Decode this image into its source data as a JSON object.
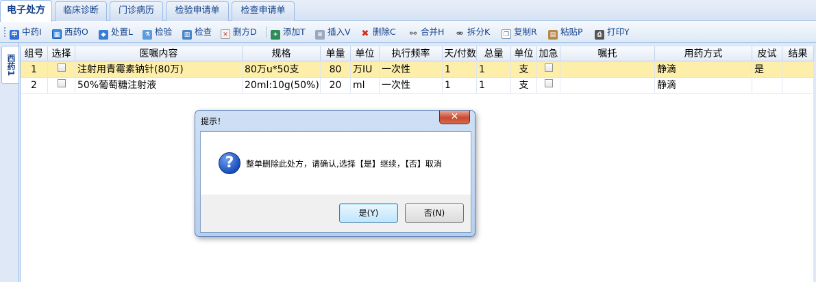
{
  "tabs": [
    {
      "label": "电子处方",
      "active": true
    },
    {
      "label": "临床诊断",
      "active": false
    },
    {
      "label": "门诊病历",
      "active": false
    },
    {
      "label": "检验申请单",
      "active": false
    },
    {
      "label": "检查申请单",
      "active": false
    }
  ],
  "toolbar": {
    "items": [
      {
        "label": "中药I",
        "icon": "herbal-icon"
      },
      {
        "label": "西药O",
        "icon": "medicine-icon"
      },
      {
        "label": "处置L",
        "icon": "treatment-icon"
      },
      {
        "label": "检验",
        "icon": "lab-test-icon"
      },
      {
        "label": "检查",
        "icon": "exam-icon"
      },
      {
        "label": "删方D",
        "icon": "delete-prescription-icon"
      },
      {
        "label": "添加T",
        "icon": "add-icon"
      },
      {
        "label": "插入V",
        "icon": "insert-icon"
      },
      {
        "label": "删除C",
        "icon": "delete-icon"
      },
      {
        "label": "合并H",
        "icon": "merge-icon"
      },
      {
        "label": "拆分K",
        "icon": "split-icon"
      },
      {
        "label": "复制R",
        "icon": "copy-icon"
      },
      {
        "label": "粘贴P",
        "icon": "paste-icon"
      },
      {
        "label": "打印Y",
        "icon": "printer-icon"
      }
    ]
  },
  "side_tab": {
    "label": "西药1"
  },
  "grid": {
    "headers": [
      "组号",
      "选择",
      "医嘱内容",
      "规格",
      "单量",
      "单位",
      "执行频率",
      "天/付数",
      "总量",
      "单位",
      "加急",
      "嘱托",
      "用药方式",
      "皮试",
      "结果"
    ],
    "rows": [
      {
        "group": "1",
        "content": "注射用青霉素钠针(80万)",
        "spec": "80万u*50支",
        "dose": "80",
        "unit": "万IU",
        "freq": "一次性",
        "days": "1",
        "total": "1",
        "total_unit": "支",
        "note": "",
        "route": "静滴",
        "skin_test": "是",
        "result": "",
        "selected": true
      },
      {
        "group": "2",
        "content": "50%葡萄糖注射液",
        "spec": "20ml:10g(50%)",
        "dose": "20",
        "unit": "ml",
        "freq": "一次性",
        "days": "1",
        "total": "1",
        "total_unit": "支",
        "note": "",
        "route": "静滴",
        "skin_test": "",
        "result": "",
        "selected": false
      }
    ]
  },
  "dialog": {
    "title": "提示！",
    "close": "✕",
    "icon": "question-icon",
    "message": "整单删除此处方，请确认,选择【是】继续，【否】取消",
    "yes": "是(Y)",
    "no": "否(N)"
  }
}
